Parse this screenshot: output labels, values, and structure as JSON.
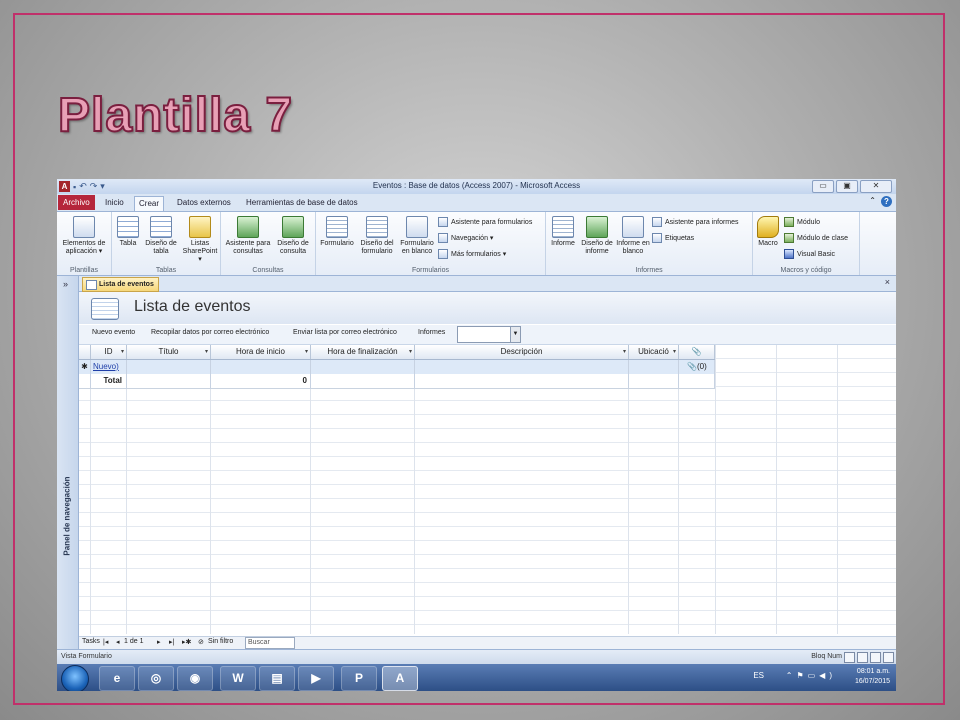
{
  "slide": {
    "title": "Plantilla 7"
  },
  "window": {
    "title": "Eventos : Base de datos (Access 2007) - Microsoft Access",
    "qat_app_icon": "A",
    "controls": {
      "minimize": "▭",
      "maximize": "▣",
      "close": "✕"
    }
  },
  "tabs": [
    {
      "label": "Archivo"
    },
    {
      "label": "Inicio"
    },
    {
      "label": "Crear"
    },
    {
      "label": "Datos externos"
    },
    {
      "label": "Herramientas de base de datos"
    }
  ],
  "ribbon": {
    "plantillas": {
      "label": "Plantillas",
      "app_parts": "Elementos de aplicación ▾"
    },
    "tablas": {
      "label": "Tablas",
      "tabla": "Tabla",
      "diseno": "Diseño de tabla",
      "listas": "Listas SharePoint ▾"
    },
    "consultas": {
      "label": "Consultas",
      "asistente": "Asistente para consultas",
      "diseno": "Diseño de consulta"
    },
    "formularios": {
      "label": "Formularios",
      "formulario": "Formulario",
      "diseno": "Diseño del formulario",
      "blanco": "Formulario en blanco",
      "asistente": "Asistente para formularios",
      "navegacion": "Navegación ▾",
      "mas": "Más formularios ▾"
    },
    "informes": {
      "label": "Informes",
      "informe": "Informe",
      "diseno": "Diseño de informe",
      "blanco": "Informe en blanco",
      "asistente": "Asistente para informes",
      "etiquetas": "Etiquetas"
    },
    "macros": {
      "label": "Macros y código",
      "macro": "Macro",
      "modulo": "Módulo",
      "modulo_clase": "Módulo de clase",
      "vb": "Visual Basic"
    }
  },
  "nav_pane": {
    "expand": "»",
    "label": "Panel de navegación"
  },
  "doc_tab": {
    "label": "Lista de eventos",
    "close": "×"
  },
  "form": {
    "title": "Lista de eventos",
    "actions": {
      "nuevo": "Nuevo evento",
      "recopilar": "Recopilar datos por correo electrónico",
      "enviar": "Enviar lista por correo electrónico",
      "informes_label": "Informes",
      "informes_value": ""
    }
  },
  "table": {
    "columns": [
      {
        "label": "ID"
      },
      {
        "label": "Título"
      },
      {
        "label": "Hora de inicio"
      },
      {
        "label": "Hora de finalización"
      },
      {
        "label": "Descripción"
      },
      {
        "label": "Ubicació"
      },
      {
        "label": "📎"
      }
    ],
    "new_row": {
      "marker": "✱",
      "id": "Nuevo)",
      "attachments": "(0)"
    },
    "total_row": {
      "label": "Total",
      "hora_inicio": "0"
    }
  },
  "record_nav": {
    "label": "Tasks",
    "first": "|◂",
    "prev": "◂",
    "position": "1 de 1",
    "next": "▸",
    "last": "▸|",
    "new": "▸✱",
    "filter": "Sin filtro",
    "search": "Buscar"
  },
  "status": {
    "left": "Vista Formulario",
    "right": "Bloq Num"
  },
  "taskbar": {
    "lang": "ES",
    "time": "08:01 a.m.",
    "date": "16/07/2015",
    "apps": [
      "e",
      "◎",
      "◉",
      "W",
      "▤",
      "▶",
      "P",
      "A"
    ]
  },
  "colors": {
    "accent": "#b5263b",
    "frame": "#c0306a",
    "ribbon": "#dbe6f4"
  }
}
